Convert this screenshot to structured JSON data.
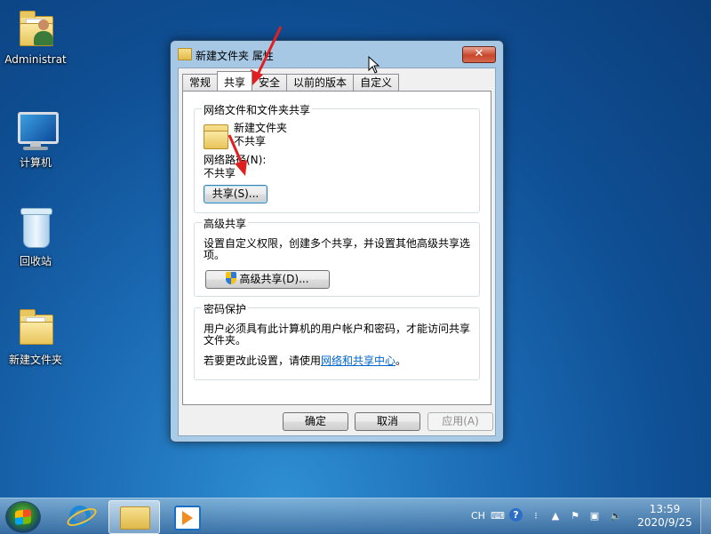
{
  "desktop": {
    "icons": [
      {
        "label": "Administrat"
      },
      {
        "label": "计算机"
      },
      {
        "label": "回收站"
      },
      {
        "label": "新建文件夹"
      }
    ]
  },
  "window": {
    "title": "新建文件夹 属性",
    "close_label": "✕",
    "tabs": [
      {
        "label": "常规"
      },
      {
        "label": "共享"
      },
      {
        "label": "安全"
      },
      {
        "label": "以前的版本"
      },
      {
        "label": "自定义"
      }
    ],
    "active_tab": "共享",
    "network_share": {
      "group_title": "网络文件和文件夹共享",
      "folder_name": "新建文件夹",
      "folder_status": "不共享",
      "path_label": "网络路径(N):",
      "path_value": "不共享",
      "share_button": "共享(S)..."
    },
    "advanced_share": {
      "group_title": "高级共享",
      "description_line1": "设置自定义权限，创建多个共享，并设置其他高级共享选",
      "description_line2": "项。",
      "button": "高级共享(D)..."
    },
    "password_protection": {
      "group_title": "密码保护",
      "description_line1": "用户必须具有此计算机的用户帐户和密码，才能访问共享",
      "description_line2": "文件夹。",
      "change_prefix": "若要更改此设置，请使用",
      "link_text": "网络和共享中心",
      "change_suffix": "。"
    },
    "buttons": {
      "ok": "确定",
      "cancel": "取消",
      "apply": "应用(A)"
    }
  },
  "taskbar": {
    "language": "CH",
    "help_icon": "?",
    "time": "13:59",
    "date": "2020/9/25"
  },
  "colors": {
    "arrow": "#e02020",
    "link": "#0066cc"
  }
}
